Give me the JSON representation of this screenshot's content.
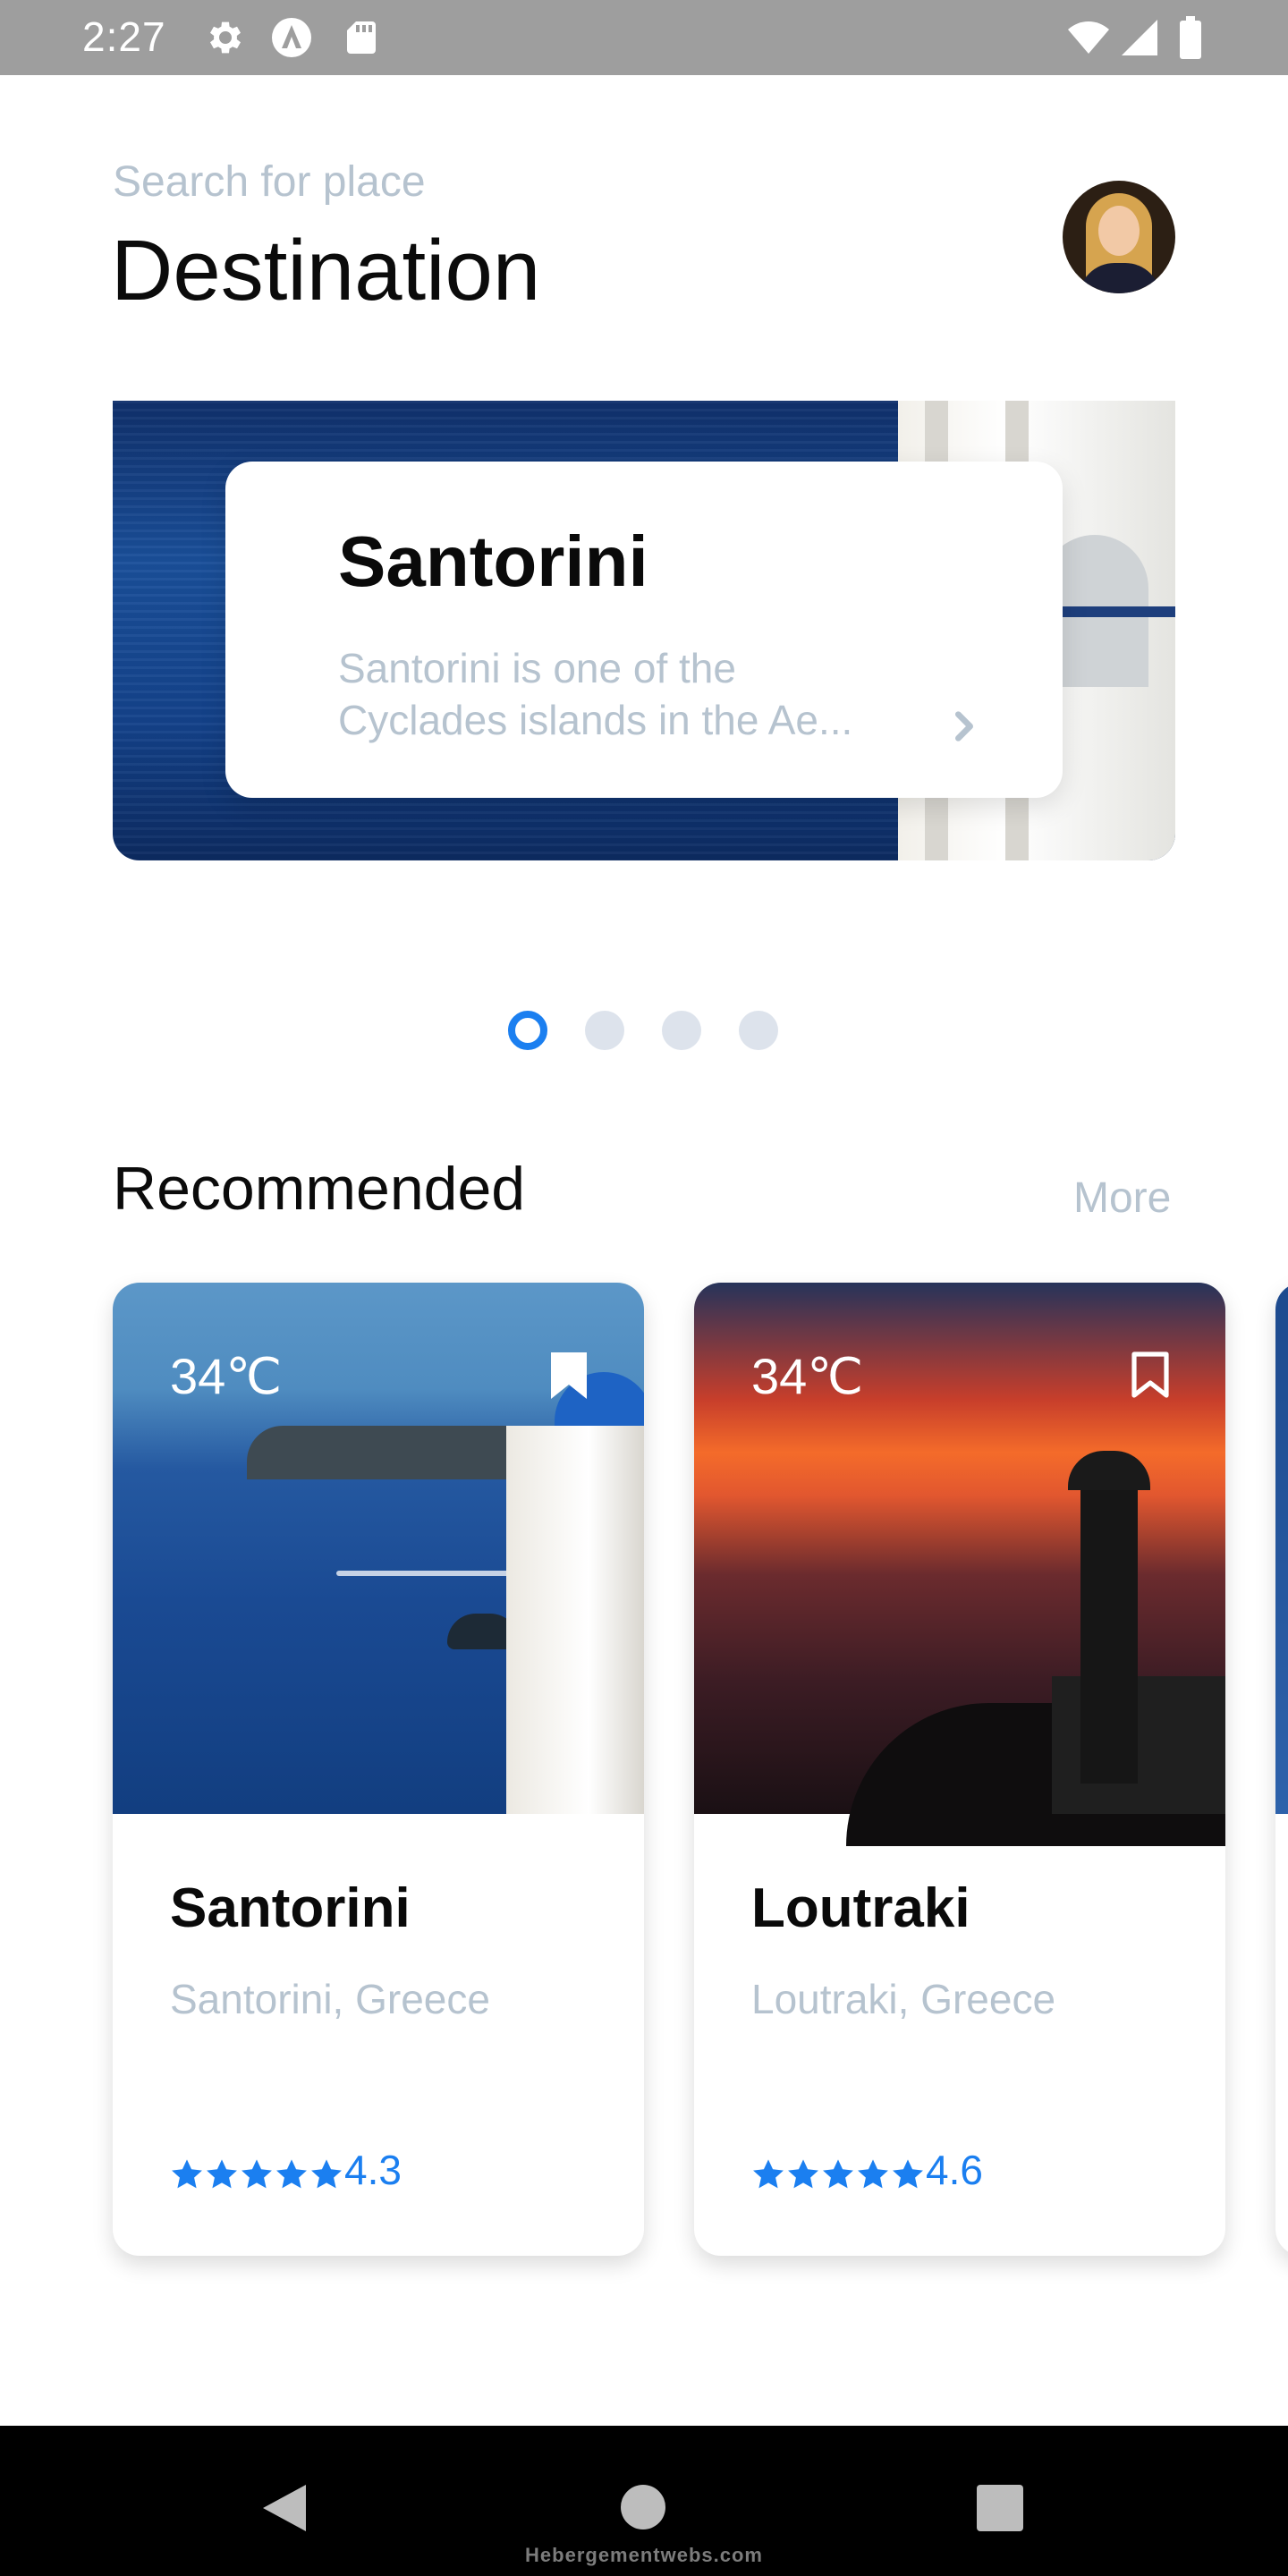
{
  "status_bar": {
    "time": "2:27",
    "icons": [
      "settings-icon",
      "app-a-icon",
      "sd-card-icon",
      "wifi-icon",
      "signal-icon",
      "battery-icon"
    ]
  },
  "header": {
    "subtitle": "Search for place",
    "title": "Destination"
  },
  "hero": {
    "title": "Santorini",
    "description": "Santorini is one of the Cyclades islands in the Ae...",
    "pager_count": 4,
    "pager_active": 0
  },
  "recommended": {
    "title": "Recommended",
    "more_label": "More",
    "cards": [
      {
        "temperature": "34℃",
        "name": "Santorini",
        "location": "Santorini, Greece",
        "rating": "4.3",
        "bookmarked": true
      },
      {
        "temperature": "34℃",
        "name": "Loutraki",
        "location": "Loutraki, Greece",
        "rating": "4.6",
        "bookmarked": false
      }
    ]
  },
  "nav_bar": {
    "brand": "Hebergementwebs.com"
  },
  "colors": {
    "accent": "#1b7ff0",
    "muted_text": "#b6c3cf",
    "status_bar": "#9e9e9e"
  }
}
